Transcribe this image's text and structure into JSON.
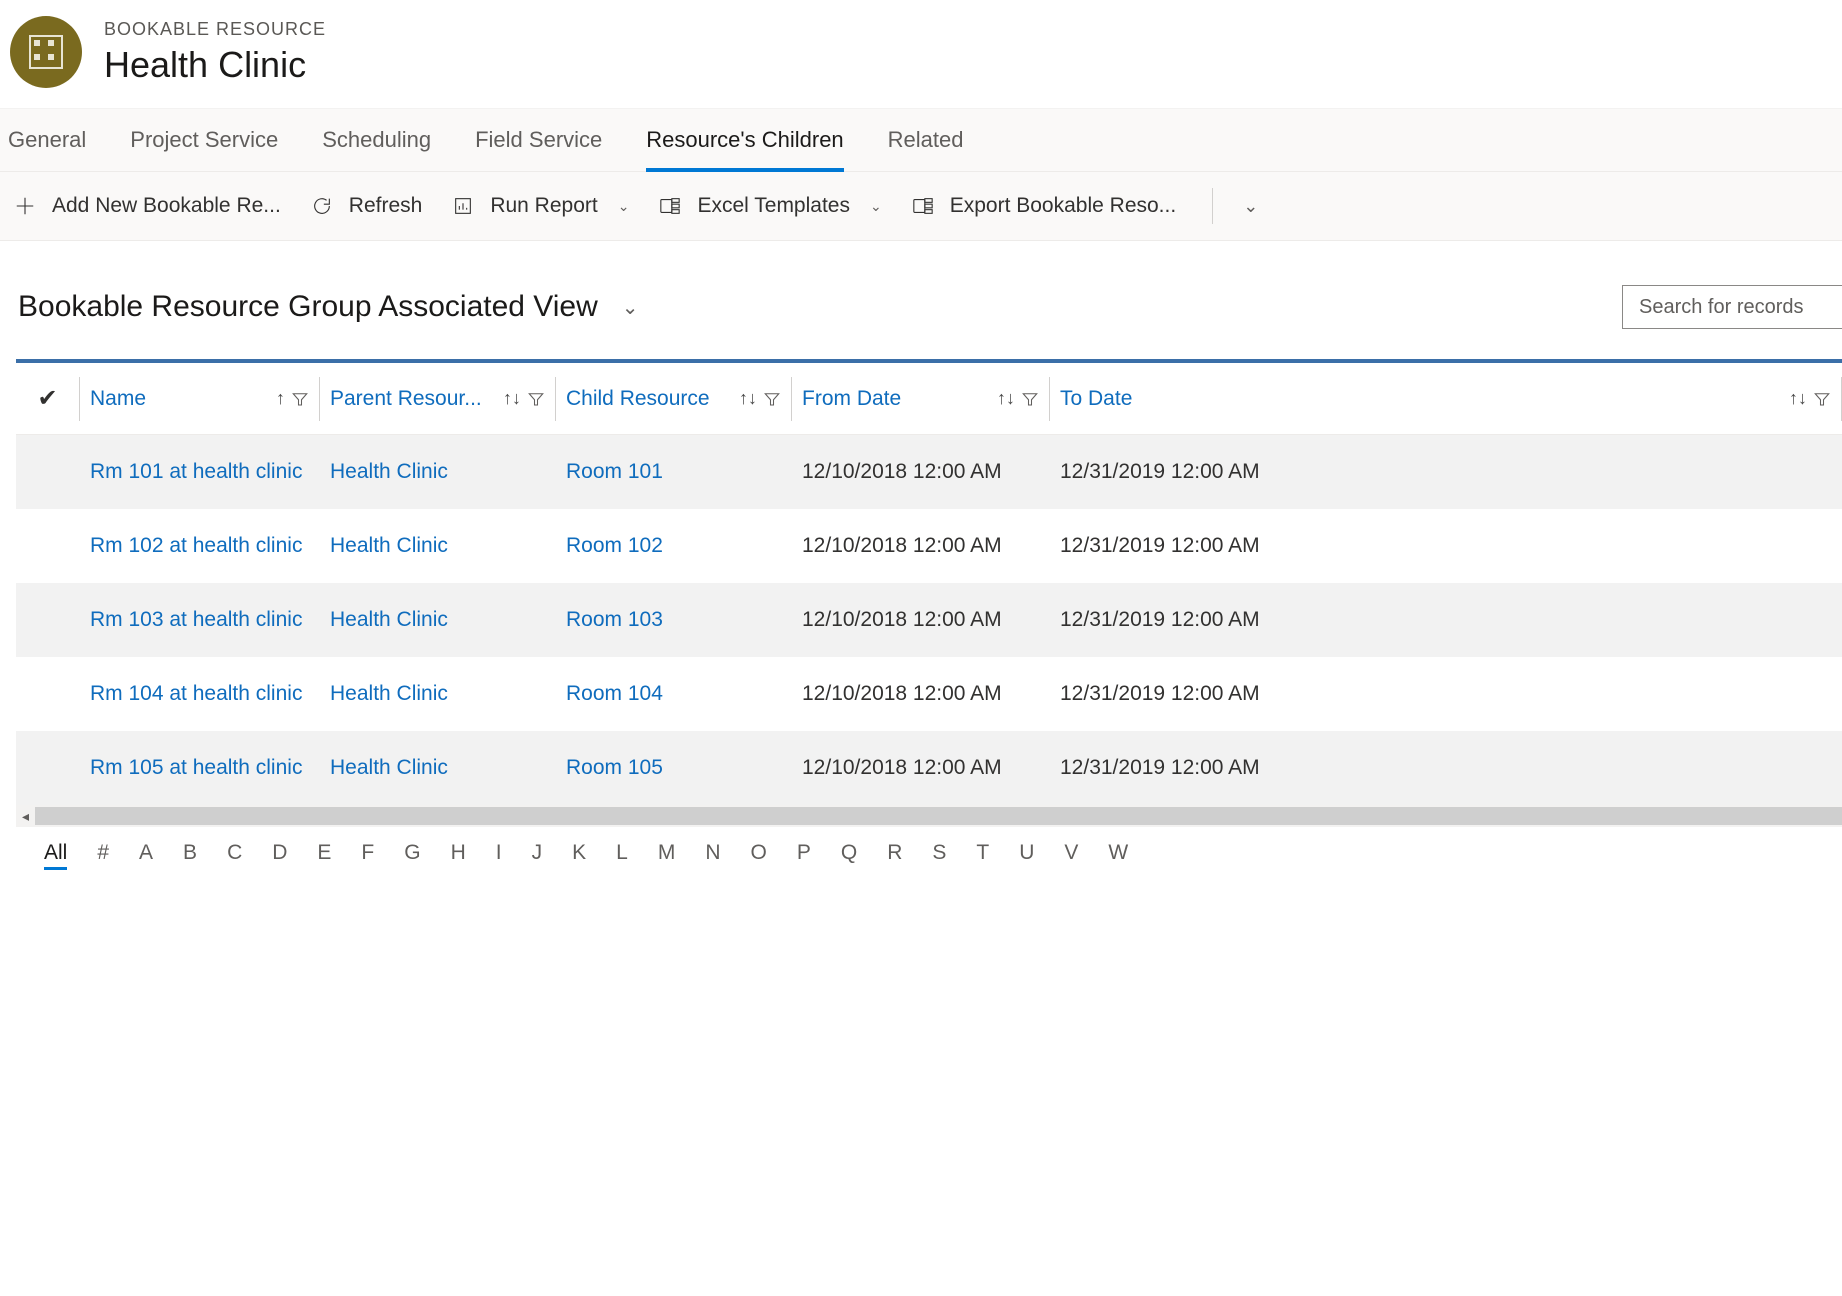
{
  "header": {
    "entity_label": "BOOKABLE RESOURCE",
    "title": "Health Clinic"
  },
  "tabs": [
    {
      "label": "General",
      "active": false
    },
    {
      "label": "Project Service",
      "active": false
    },
    {
      "label": "Scheduling",
      "active": false
    },
    {
      "label": "Field Service",
      "active": false
    },
    {
      "label": "Resource's Children",
      "active": true
    },
    {
      "label": "Related",
      "active": false
    }
  ],
  "toolbar": {
    "add_new": "Add New Bookable Re...",
    "refresh": "Refresh",
    "run_report": "Run Report",
    "excel_templates": "Excel Templates",
    "export": "Export Bookable Reso..."
  },
  "view": {
    "title": "Bookable Resource Group Associated View",
    "search_placeholder": "Search for records"
  },
  "columns": {
    "name": "Name",
    "parent": "Parent Resour...",
    "child": "Child Resource",
    "from": "From Date",
    "to": "To Date"
  },
  "rows": [
    {
      "name": "Rm 101 at health clinic",
      "parent": "Health Clinic",
      "child": "Room 101",
      "from": "12/10/2018 12:00 AM",
      "to": "12/31/2019 12:00 AM"
    },
    {
      "name": "Rm 102 at health clinic",
      "parent": "Health Clinic",
      "child": "Room 102",
      "from": "12/10/2018 12:00 AM",
      "to": "12/31/2019 12:00 AM"
    },
    {
      "name": "Rm 103 at health clinic",
      "parent": "Health Clinic",
      "child": "Room 103",
      "from": "12/10/2018 12:00 AM",
      "to": "12/31/2019 12:00 AM"
    },
    {
      "name": "Rm 104 at health clinic",
      "parent": "Health Clinic",
      "child": "Room 104",
      "from": "12/10/2018 12:00 AM",
      "to": "12/31/2019 12:00 AM"
    },
    {
      "name": "Rm 105 at health clinic",
      "parent": "Health Clinic",
      "child": "Room 105",
      "from": "12/10/2018 12:00 AM",
      "to": "12/31/2019 12:00 AM"
    }
  ],
  "alpha": [
    "All",
    "#",
    "A",
    "B",
    "C",
    "D",
    "E",
    "F",
    "G",
    "H",
    "I",
    "J",
    "K",
    "L",
    "M",
    "N",
    "O",
    "P",
    "Q",
    "R",
    "S",
    "T",
    "U",
    "V",
    "W"
  ],
  "alpha_active": "All"
}
